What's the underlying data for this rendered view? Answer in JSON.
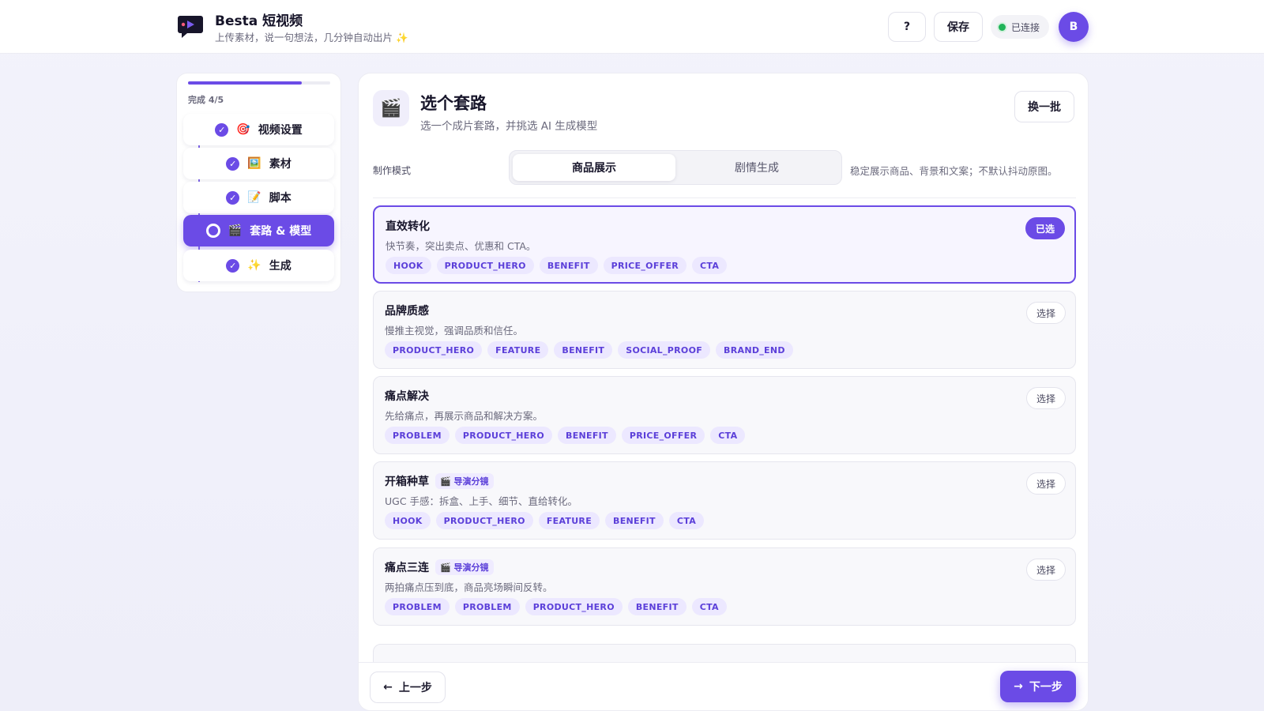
{
  "header": {
    "app_title": "Besta 短视频",
    "app_subtitle": "上传素材，说一句想法，几分钟自动出片 ✨",
    "help_label": "?",
    "save_label": "保存",
    "connection_status": "已连接",
    "avatar_initial": "B"
  },
  "sidebar": {
    "progress_label": "完成 4/5",
    "progress": 0.8,
    "steps": [
      {
        "label": "视频设置",
        "emoji": "🎯",
        "state": "done"
      },
      {
        "label": "素材",
        "emoji": "🖼️",
        "state": "done"
      },
      {
        "label": "脚本",
        "emoji": "📝",
        "state": "done"
      },
      {
        "label": "套路 & 模型",
        "emoji": "🎬",
        "state": "active"
      },
      {
        "label": "生成",
        "emoji": "✨",
        "state": "done"
      }
    ]
  },
  "main": {
    "icon": "🎬",
    "title": "选个套路",
    "subtitle": "选一个成片套路，并挑选 AI 生成模型",
    "shuffle_label": "换一批",
    "mode_label": "制作模式",
    "modes": [
      "商品展示",
      "剧情生成"
    ],
    "selected_mode": "商品展示",
    "mode_hint": "稳定展示商品、背景和文案；不默认抖动原图。",
    "cards": [
      {
        "title": "直效转化",
        "badge": "",
        "desc": "快节奏，突出卖点、优惠和 CTA。",
        "tags": [
          "HOOK",
          "PRODUCT_HERO",
          "BENEFIT",
          "PRICE_OFFER",
          "CTA"
        ],
        "button": "已选",
        "selected": true
      },
      {
        "title": "品牌质感",
        "badge": "",
        "desc": "慢推主视觉，强调品质和信任。",
        "tags": [
          "PRODUCT_HERO",
          "FEATURE",
          "BENEFIT",
          "SOCIAL_PROOF",
          "BRAND_END"
        ],
        "button": "选择",
        "selected": false
      },
      {
        "title": "痛点解决",
        "badge": "",
        "desc": "先给痛点，再展示商品和解决方案。",
        "tags": [
          "PROBLEM",
          "PRODUCT_HERO",
          "BENEFIT",
          "PRICE_OFFER",
          "CTA"
        ],
        "button": "选择",
        "selected": false
      },
      {
        "title": "开箱种草",
        "badge": "🎬 导演分镜",
        "desc": "UGC 手感：拆盒、上手、细节、直给转化。",
        "tags": [
          "HOOK",
          "PRODUCT_HERO",
          "FEATURE",
          "BENEFIT",
          "CTA"
        ],
        "button": "选择",
        "selected": false
      },
      {
        "title": "痛点三连",
        "badge": "🎬 导演分镜",
        "desc": "两拍痛点压到底，商品亮场瞬间反转。",
        "tags": [
          "PROBLEM",
          "PROBLEM",
          "PRODUCT_HERO",
          "BENEFIT",
          "CTA"
        ],
        "button": "选择",
        "selected": false
      }
    ],
    "prev_label": "上一步",
    "next_label": "下一步"
  },
  "colors": {
    "accent": "#6b4be6",
    "connected": "#22b45a"
  }
}
